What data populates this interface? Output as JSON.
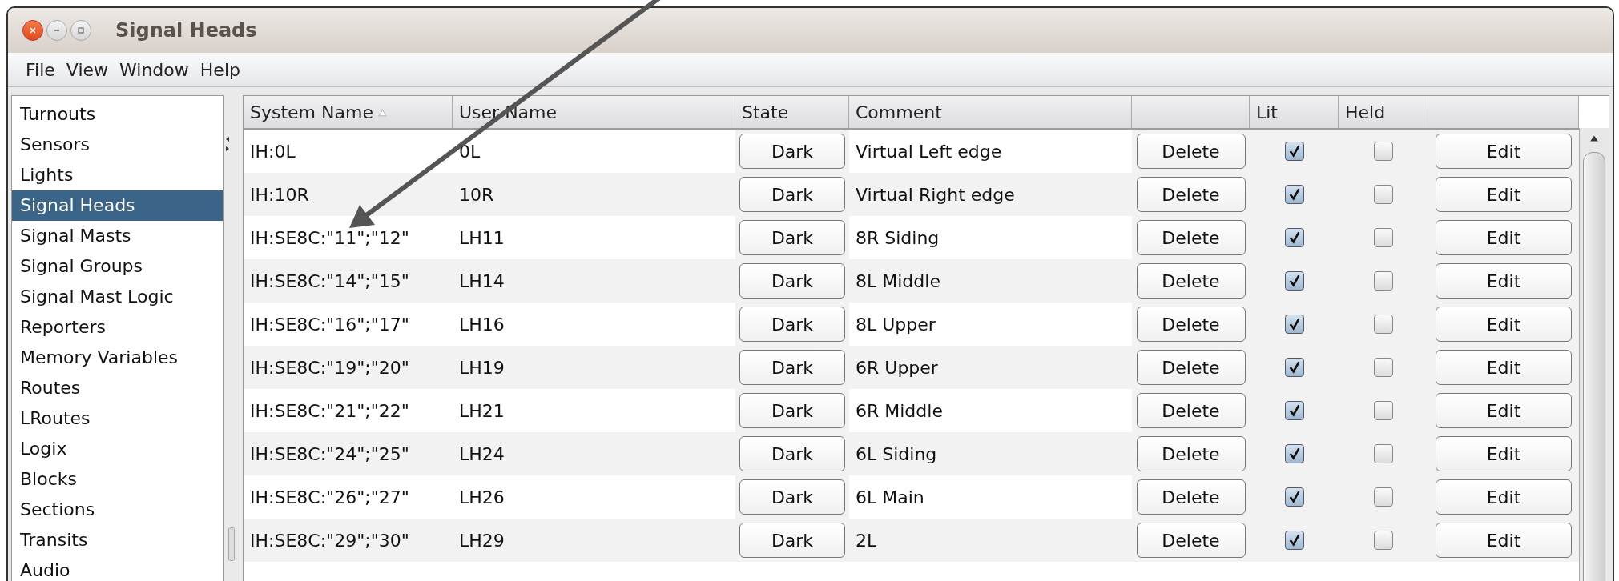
{
  "window": {
    "title": "Signal Heads"
  },
  "menu": [
    "File",
    "View",
    "Window",
    "Help"
  ],
  "sidebar": {
    "items": [
      {
        "label": "Turnouts",
        "selected": false
      },
      {
        "label": "Sensors",
        "selected": false
      },
      {
        "label": "Lights",
        "selected": false
      },
      {
        "label": "Signal Heads",
        "selected": true
      },
      {
        "label": "Signal Masts",
        "selected": false
      },
      {
        "label": "Signal Groups",
        "selected": false
      },
      {
        "label": "Signal Mast Logic",
        "selected": false
      },
      {
        "label": "Reporters",
        "selected": false
      },
      {
        "label": "Memory Variables",
        "selected": false
      },
      {
        "label": "Routes",
        "selected": false
      },
      {
        "label": "LRoutes",
        "selected": false
      },
      {
        "label": "Logix",
        "selected": false
      },
      {
        "label": "Blocks",
        "selected": false
      },
      {
        "label": "Sections",
        "selected": false
      },
      {
        "label": "Transits",
        "selected": false
      },
      {
        "label": "Audio",
        "selected": false
      }
    ]
  },
  "table": {
    "columns": [
      "System Name",
      "User Name",
      "State",
      "Comment",
      "Lit",
      "Held"
    ],
    "rows": [
      {
        "system_name": "IH:0L",
        "user_name": "0L",
        "state": "Dark",
        "comment": "Virtual Left edge",
        "delete": "Delete",
        "lit": true,
        "held": false,
        "edit": "Edit"
      },
      {
        "system_name": "IH:10R",
        "user_name": "10R",
        "state": "Dark",
        "comment": "Virtual Right edge",
        "delete": "Delete",
        "lit": true,
        "held": false,
        "edit": "Edit"
      },
      {
        "system_name": "IH:SE8C:\"11\";\"12\"",
        "user_name": "LH11",
        "state": "Dark",
        "comment": "8R Siding",
        "delete": "Delete",
        "lit": true,
        "held": false,
        "edit": "Edit"
      },
      {
        "system_name": "IH:SE8C:\"14\";\"15\"",
        "user_name": "LH14",
        "state": "Dark",
        "comment": "8L Middle",
        "delete": "Delete",
        "lit": true,
        "held": false,
        "edit": "Edit"
      },
      {
        "system_name": "IH:SE8C:\"16\";\"17\"",
        "user_name": "LH16",
        "state": "Dark",
        "comment": "8L Upper",
        "delete": "Delete",
        "lit": true,
        "held": false,
        "edit": "Edit"
      },
      {
        "system_name": "IH:SE8C:\"19\";\"20\"",
        "user_name": "LH19",
        "state": "Dark",
        "comment": "6R Upper",
        "delete": "Delete",
        "lit": true,
        "held": false,
        "edit": "Edit"
      },
      {
        "system_name": "IH:SE8C:\"21\";\"22\"",
        "user_name": "LH21",
        "state": "Dark",
        "comment": "6R Middle",
        "delete": "Delete",
        "lit": true,
        "held": false,
        "edit": "Edit"
      },
      {
        "system_name": "IH:SE8C:\"24\";\"25\"",
        "user_name": "LH24",
        "state": "Dark",
        "comment": "6L Siding",
        "delete": "Delete",
        "lit": true,
        "held": false,
        "edit": "Edit"
      },
      {
        "system_name": "IH:SE8C:\"26\";\"27\"",
        "user_name": "LH26",
        "state": "Dark",
        "comment": "6L Main",
        "delete": "Delete",
        "lit": true,
        "held": false,
        "edit": "Edit"
      },
      {
        "system_name": "IH:SE8C:\"29\";\"30\"",
        "user_name": "LH29",
        "state": "Dark",
        "comment": "2L",
        "delete": "Delete",
        "lit": true,
        "held": false,
        "edit": "Edit"
      }
    ]
  }
}
